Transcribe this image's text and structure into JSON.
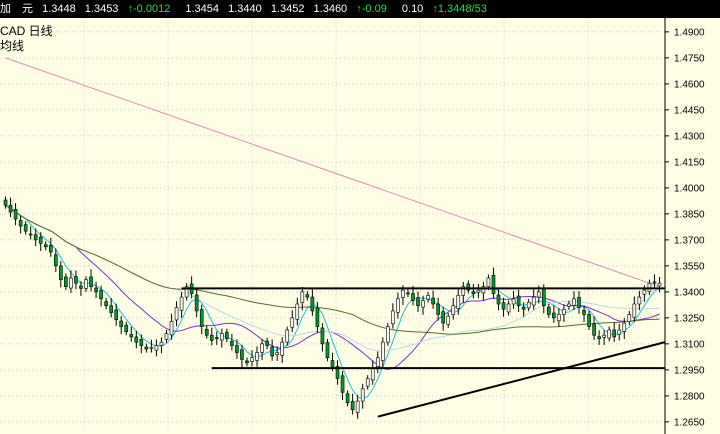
{
  "quote_bar": {
    "name": "加　元",
    "values": [
      "1.3448",
      "1.3453"
    ],
    "change": "-0.0012",
    "values2": [
      "1.3454",
      "1.3440",
      "1.3452",
      "1.3460"
    ],
    "change_pct": "-0.09",
    "volume": "0.10",
    "last": "1.3448/53",
    "up_color": "#2BD94B"
  },
  "labels": {
    "symbol_line": "CAD  日线",
    "line2": "均线"
  },
  "chart_data": {
    "type": "candlestick",
    "background": "#FFFFE5",
    "y_axis": {
      "side": "right",
      "range": [
        1.258,
        1.498
      ],
      "ticks": [
        "1.4900",
        "1.4750",
        "1.4600",
        "1.4450",
        "1.4300",
        "1.4150",
        "1.4000",
        "1.3850",
        "1.3700",
        "1.3550",
        "1.3400",
        "1.3250",
        "1.3100",
        "1.2950",
        "1.2800",
        "1.2650"
      ],
      "grid": true
    },
    "candle_count": 131,
    "closes": [
      1.39,
      1.386,
      1.382,
      1.378,
      1.375,
      1.373,
      1.37,
      1.368,
      1.366,
      1.363,
      1.355,
      1.347,
      1.343,
      1.348,
      1.345,
      1.342,
      1.347,
      1.343,
      1.34,
      1.336,
      1.332,
      1.328,
      1.324,
      1.32,
      1.317,
      1.314,
      1.311,
      1.309,
      1.307,
      1.308,
      1.309,
      1.311,
      1.316,
      1.323,
      1.331,
      1.337,
      1.343,
      1.339,
      1.329,
      1.32,
      1.315,
      1.312,
      1.313,
      1.316,
      1.313,
      1.309,
      1.305,
      1.301,
      1.299,
      1.302,
      1.305,
      1.31,
      1.309,
      1.303,
      1.305,
      1.311,
      1.318,
      1.325,
      1.333,
      1.34,
      1.337,
      1.329,
      1.32,
      1.31,
      1.302,
      1.297,
      1.29,
      1.282,
      1.276,
      1.272,
      1.277,
      1.284,
      1.29,
      1.296,
      1.302,
      1.311,
      1.32,
      1.329,
      1.336,
      1.341,
      1.339,
      1.335,
      1.332,
      1.335,
      1.338,
      1.333,
      1.327,
      1.322,
      1.326,
      1.332,
      1.338,
      1.343,
      1.341,
      1.339,
      1.341,
      1.343,
      1.348,
      1.339,
      1.333,
      1.33,
      1.333,
      1.336,
      1.332,
      1.33,
      1.334,
      1.337,
      1.34,
      1.332,
      1.327,
      1.325,
      1.327,
      1.33,
      1.333,
      1.336,
      1.331,
      1.327,
      1.32,
      1.315,
      1.313,
      1.315,
      1.318,
      1.314,
      1.318,
      1.322,
      1.327,
      1.333,
      1.337,
      1.341,
      1.345,
      1.345,
      1.345
    ],
    "series": [
      {
        "kind": "ma",
        "color": "#22BBDD",
        "period": 5
      },
      {
        "kind": "ma",
        "color": "#7733CC",
        "period": 15
      },
      {
        "kind": "ma",
        "color": "#B8D8E8",
        "period": 35
      },
      {
        "kind": "ma",
        "color": "#556B2F",
        "period": 70
      },
      {
        "kind": "line",
        "color": "#E08BB0",
        "from": 1.475,
        "to": 1.343
      }
    ],
    "annotations": [
      {
        "kind": "horizontal",
        "y": 1.342,
        "from_index": 35,
        "to_index": 131
      },
      {
        "kind": "horizontal",
        "y": 1.296,
        "from_index": 41,
        "to_index": 131
      },
      {
        "kind": "trend",
        "y1": 1.268,
        "from_index": 74,
        "y2": 1.311,
        "to_index": 131
      }
    ],
    "up_color": "#F5F5F5",
    "down_color": "#009933",
    "candle_edge": "#000000"
  }
}
